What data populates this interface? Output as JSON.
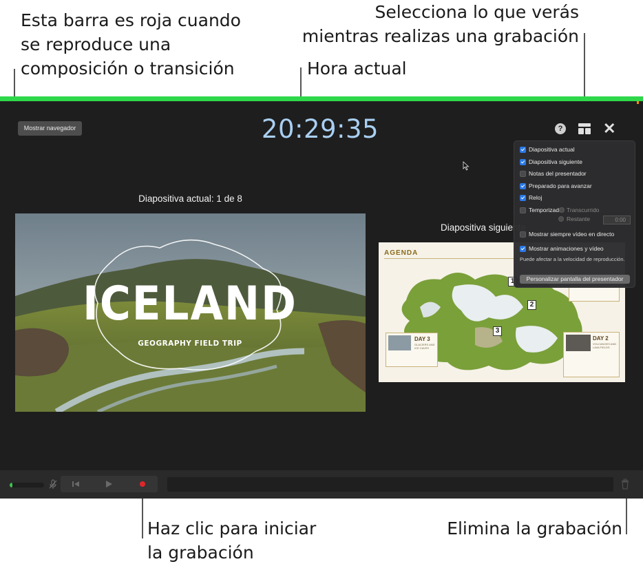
{
  "callouts": {
    "red_bar": [
      "Esta barra es roja cuando",
      "se reproduce una",
      "composición o transición"
    ],
    "current_time": "Hora actual",
    "layout_select": [
      "Selecciona lo que verás",
      "mientras realizas una grabación"
    ],
    "record_start": [
      "Haz clic para iniciar",
      "la grabación"
    ],
    "delete_recording": "Elimina la grabación"
  },
  "toolbar": {
    "navigator_button": "Mostrar navegador",
    "clock": "20:29:35",
    "help_icon": "help-icon",
    "layout_icon": "layout-icon",
    "close_icon": "close-icon"
  },
  "current_slide": {
    "label": "Diapositiva actual: 1 de 8",
    "title": "ICELAND",
    "subtitle": "GEOGRAPHY FIELD TRIP"
  },
  "next_slide": {
    "label": "Diapositiva siguiente",
    "agenda_title": "AGENDA",
    "day3_title": "DAY 3",
    "day3_sub": "GLACIERS AND ICE CAVES",
    "day2_title": "DAY 2",
    "day2_sub": "VOLCANOES AND LAVA FIELDS",
    "map_numbers": [
      "1",
      "2",
      "3"
    ]
  },
  "popover": {
    "options": [
      {
        "label": "Diapositiva actual",
        "checked": true
      },
      {
        "label": "Diapositiva siguiente",
        "checked": true
      },
      {
        "label": "Notas del presentador",
        "checked": false
      },
      {
        "label": "Preparado para avanzar",
        "checked": true
      },
      {
        "label": "Reloj",
        "checked": true
      },
      {
        "label": "Temporizador",
        "checked": false
      }
    ],
    "timer_elapsed": "Transcurrido",
    "timer_remaining": "Restante",
    "timer_value": "0:00",
    "show_live_video": {
      "label": "Mostrar siempre vídeo en directo",
      "checked": false
    },
    "show_animations": {
      "label": "Mostrar animaciones y vídeo",
      "checked": true
    },
    "performance_note": "Puede afectar a la velocidad de reproducción.",
    "customize_button": "Personalizar pantalla del presentador"
  },
  "recording_bar": {
    "status_color": "#2fd74a",
    "record_color": "#e0262b",
    "audio_level": 0.08
  }
}
